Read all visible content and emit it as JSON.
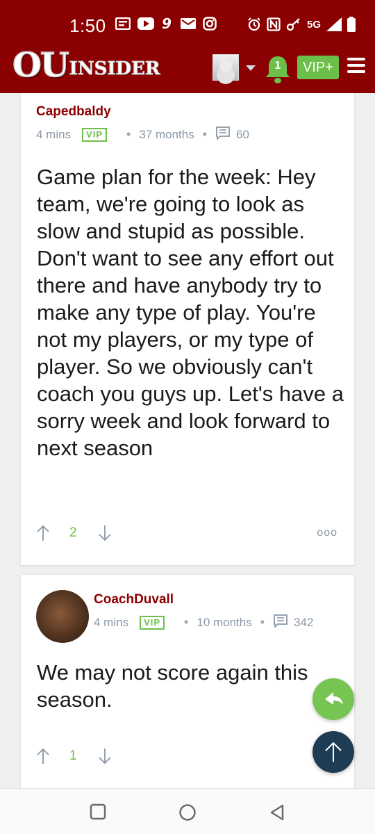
{
  "status_bar": {
    "time": "1:50",
    "network": "5G",
    "notification_icons": [
      "news-icon",
      "youtube-icon",
      "app-9-icon",
      "mail-icon",
      "instagram-icon"
    ],
    "system_icons": [
      "alarm-icon",
      "nfc-icon",
      "key-icon",
      "signal-icon",
      "battery-icon"
    ]
  },
  "header": {
    "logo_ou": "OU",
    "logo_insider": "INSIDER",
    "notification_count": "1",
    "vip_label": "VIP+",
    "colors": {
      "brand": "#8b0000",
      "accent_green": "#6cc04a"
    }
  },
  "posts": [
    {
      "username": "Capedbaldy",
      "time": "4 mins",
      "badge": "VIP",
      "membership": "37 months",
      "comment_count": "60",
      "body": "Game plan for the week: Hey team, we're going to look as slow and stupid as possible. Don't want to see any effort out there and have anybody try to make any type of play. You're not my players, or my type of player. So we obviously can't coach you guys up. Let's have a sorry week and look forward to next season",
      "score": "2",
      "more": "ooo"
    },
    {
      "username": "CoachDuvall",
      "time": "4 mins",
      "badge": "VIP",
      "membership": "10 months",
      "comment_count": "342",
      "body": "We may not score again this season.",
      "score": "1"
    }
  ],
  "fabs": {
    "reply": "reply-icon",
    "top": "arrow-up-icon"
  },
  "nav_bar": {
    "buttons": [
      "recents-icon",
      "home-icon",
      "back-icon"
    ]
  }
}
